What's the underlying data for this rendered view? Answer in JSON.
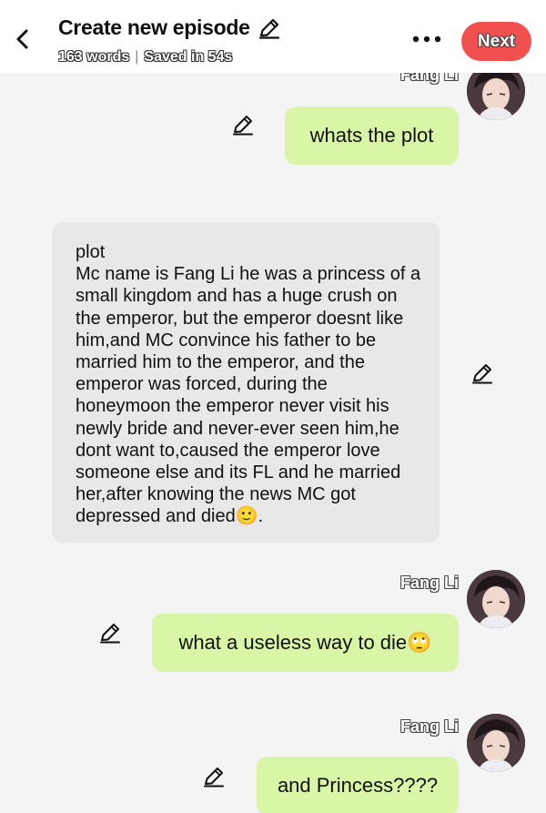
{
  "header": {
    "title": "Create new episode",
    "word_count": "163 words",
    "saved_status": "Saved in 54s",
    "next_label": "Next"
  },
  "messages": [
    {
      "sender": "Fang Li",
      "text": "whats the plot",
      "side": "right"
    },
    {
      "sender": "",
      "text": "plot\nMc name is Fang Li he was a princess of a small kingdom and has a huge crush on the emperor, but the emperor doesnt like him,and MC convince his father to be married him to the emperor, and the emperor was forced, during the honeymoon the emperor never visit his newly bride and never-ever seen him,he dont want to,caused the emperor love someone else and its FL and he married her,after knowing the news MC got depressed and died🙂.",
      "side": "left"
    },
    {
      "sender": "Fang Li",
      "text": "what a useless way to die🙄",
      "side": "right"
    },
    {
      "sender": "Fang Li",
      "text": "and Princess????",
      "side": "right"
    }
  ],
  "colors": {
    "accent": "#f2504f",
    "own_bubble": "#d9f5a6",
    "other_bubble": "#e8e8e8",
    "background": "#f4f4f4"
  },
  "icons": [
    "back-arrow-icon",
    "pencil-icon",
    "more-icon",
    "edit-icon",
    "avatar"
  ]
}
